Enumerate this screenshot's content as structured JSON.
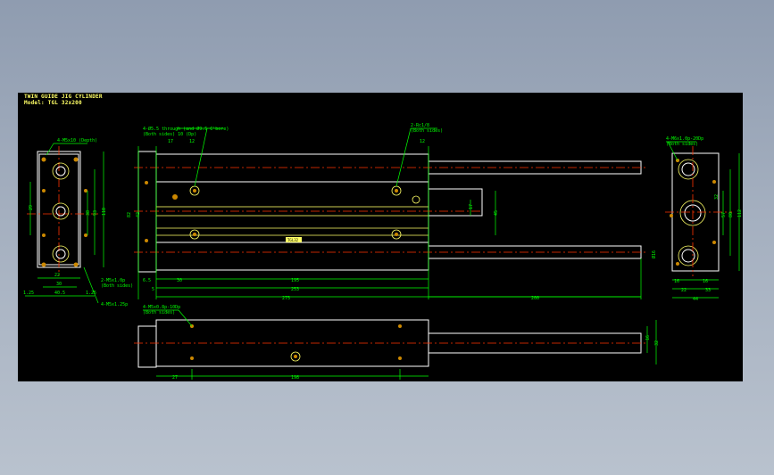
{
  "title": {
    "line1": "TWIN GUIDE JIG CYLINDER",
    "line2": "Model: TGL 32x200"
  },
  "colors": {
    "background": "#000000",
    "outline": "#ffffff",
    "dimension": "#00ff00",
    "centerline": "#ff3300",
    "hidden": "#ffff66",
    "hole_fill": "#cc8800"
  },
  "callouts": {
    "left_top": "4-M5x10 (Depth)",
    "left_bottom1": "2-M5x1.0p",
    "left_bottom1_sub": "(Both sides)",
    "left_bottom2": "4-M5x1.25p",
    "top_left1": "4-Ø5.5 through (and Ø9.5 C'bore)",
    "top_left2": "(Both sides) 10 (Dp)",
    "top_right1": "2-Rc1/8",
    "top_right2": "(Both sides)",
    "right_top1": "4-M6x1.0p-20Dp",
    "right_top2": "(Both sides)",
    "bottom_left1": "4-M5x0.8p-10Dp",
    "bottom_left2": "(Both sides)",
    "stamp": "TGL32"
  },
  "dimensions": {
    "left_view": {
      "d22": "22",
      "d30": "30",
      "d40_5": "40.5",
      "d1_25a": "1.25",
      "d1_25b": "1.25",
      "v110": "110",
      "v93": "93",
      "v38": "38",
      "v29": "29"
    },
    "main_view": {
      "d17": "17",
      "d12a": "12",
      "d12b": "12",
      "d6_5": "6.5",
      "d5": "5",
      "d30": "30",
      "d195": "195",
      "d253": "253",
      "d275": "275",
      "d200": "200",
      "v55": "55",
      "v45": "45",
      "v17": "17",
      "v82": "82",
      "v42": "42",
      "v28": "Ø16"
    },
    "right_view": {
      "d16a": "16",
      "d16b": "16",
      "d22": "22",
      "d33": "33",
      "d44": "44",
      "v112": "112",
      "v80": "80",
      "v57": "57",
      "v32": "32"
    },
    "bottom_view": {
      "d27": "27",
      "d198": "198",
      "v16": "16",
      "v32": "32"
    }
  }
}
